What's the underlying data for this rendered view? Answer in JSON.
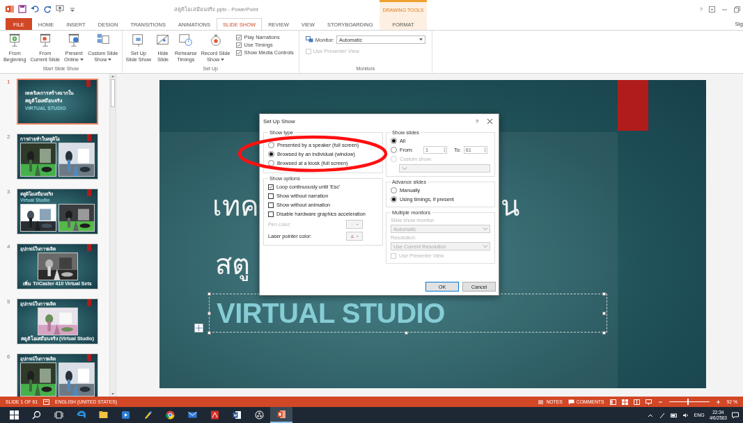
{
  "title_bar": {
    "title": "สตูดิโอเสมือนจริง.pptx - PowerPoint",
    "contextual_header": "DRAWING TOOLS",
    "help": "?",
    "account": "Sig"
  },
  "tabs": [
    {
      "label": "FILE",
      "kind": "file",
      "selected": false
    },
    {
      "label": "HOME",
      "kind": "tab",
      "selected": false
    },
    {
      "label": "INSERT",
      "kind": "tab",
      "selected": false
    },
    {
      "label": "DESIGN",
      "kind": "tab",
      "selected": false
    },
    {
      "label": "TRANSITIONS",
      "kind": "tab",
      "selected": false
    },
    {
      "label": "ANIMATIONS",
      "kind": "tab",
      "selected": false
    },
    {
      "label": "SLIDE SHOW",
      "kind": "tab",
      "selected": true
    },
    {
      "label": "REVIEW",
      "kind": "tab",
      "selected": false
    },
    {
      "label": "VIEW",
      "kind": "tab",
      "selected": false
    },
    {
      "label": "STORYBOARDING",
      "kind": "tab",
      "selected": false
    },
    {
      "label": "FORMAT",
      "kind": "contextual",
      "selected": false
    }
  ],
  "ribbon": {
    "groups": [
      {
        "label": "Start Slide Show",
        "items": [
          {
            "kind": "button",
            "label": "From\nBeginning",
            "menu": false
          },
          {
            "kind": "button",
            "label": "From\nCurrent Slide",
            "menu": false
          },
          {
            "kind": "button",
            "label": "Present\nOnline",
            "menu": true
          },
          {
            "kind": "button",
            "label": "Custom Slide\nShow",
            "menu": true
          }
        ]
      },
      {
        "label": "Set Up",
        "items": [
          {
            "kind": "button",
            "label": "Set Up\nSlide Show",
            "menu": false
          },
          {
            "kind": "button",
            "label": "Hide\nSlide",
            "menu": false
          },
          {
            "kind": "button",
            "label": "Rehearse\nTimings",
            "menu": false
          },
          {
            "kind": "button",
            "label": "Record Slide\nShow",
            "menu": true
          },
          {
            "kind": "checks",
            "checks": [
              {
                "label": "Play Narrations",
                "checked": true
              },
              {
                "label": "Use Timings",
                "checked": true
              },
              {
                "label": "Show Media Controls",
                "checked": true
              }
            ]
          }
        ]
      },
      {
        "label": "Monitors",
        "items": [
          {
            "kind": "monitor",
            "label": "Monitor:",
            "value": "Automatic",
            "presenter": {
              "label": "Use Presenter View",
              "checked": false,
              "disabled": true
            }
          }
        ]
      }
    ]
  },
  "thumbnails": [
    {
      "number": "1",
      "selected": true,
      "kind": "title",
      "lines": [
        "เทคนิคการสร้างฉากใน",
        "สตูดิโอเสมือนจริง",
        "VIRTUAL STUDIO"
      ]
    },
    {
      "number": "2",
      "selected": false,
      "kind": "two_pictures",
      "lines": [
        "การถ่ายทำในสตูดิโอ"
      ]
    },
    {
      "number": "3",
      "selected": false,
      "kind": "two_pictures",
      "lines": [
        "สตูดิโอเสมือนจริง",
        "Virtual Studio"
      ]
    },
    {
      "number": "4",
      "selected": false,
      "kind": "one_picture",
      "lines": [
        "อุปกรณ์ในการผลิต"
      ],
      "caption": "เพิ่ม TriCaster 410 Virtual Sets"
    },
    {
      "number": "5",
      "selected": false,
      "kind": "one_picture",
      "lines": [
        "อุปกรณ์ในการผลิต"
      ],
      "caption": "สตูดิโอเสมือนจริง (Virtual Studio)"
    },
    {
      "number": "6",
      "selected": false,
      "kind": "two_pictures",
      "lines": [
        "อุปกรณ์ในการผลิต"
      ]
    }
  ],
  "slide": {
    "title_line1_left": "เทค",
    "title_line1_right": "น",
    "title_line2": "สตู",
    "subtitle": "VIRTUAL STUDIO",
    "subtitle_selected": true
  },
  "dialog": {
    "title": "Set Up Show",
    "help": "?",
    "show_type": {
      "label": "Show type",
      "options": [
        {
          "label": "Presented by a speaker (full screen)",
          "selected": false
        },
        {
          "label": "Browsed by an individual (window)",
          "selected": true
        },
        {
          "label": "Browsed at a kiosk (full screen)",
          "selected": false
        }
      ]
    },
    "show_options": {
      "label": "Show options",
      "checks": [
        {
          "label": "Loop continuously until 'Esc'",
          "checked": true
        },
        {
          "label": "Show without narration",
          "checked": false
        },
        {
          "label": "Show without animation",
          "checked": false
        },
        {
          "label": "Disable hardware graphics acceleration",
          "checked": false
        }
      ],
      "pen_color": {
        "label": "Pen color:",
        "disabled": true
      },
      "laser_color": {
        "label": "Laser pointer color:",
        "disabled": false
      }
    },
    "show_slides": {
      "label": "Show slides",
      "all": {
        "label": "All",
        "selected": true
      },
      "from": {
        "label": "From:",
        "selected": false,
        "value": "1"
      },
      "to": {
        "label": "To:",
        "value": "61"
      },
      "custom": {
        "label": "Custom show:",
        "selected": false,
        "disabled": true
      }
    },
    "advance": {
      "label": "Advance slides",
      "options": [
        {
          "label": "Manually",
          "selected": false
        },
        {
          "label": "Using timings, if present",
          "selected": true
        }
      ]
    },
    "monitors": {
      "label": "Multiple monitors",
      "disabled": true,
      "monitor_label": "Slide show monitor:",
      "monitor_value": "Automatic",
      "resolution_label": "Resolution:",
      "resolution_value": "Use Current Resolution",
      "presenter": {
        "label": "Use Presenter View",
        "checked": false
      }
    },
    "buttons": [
      "OK",
      "Cancel"
    ]
  },
  "status_bar": {
    "slide_info": "SLIDE 1 OF 61",
    "language": "ENGLISH (UNITED STATES)",
    "notes": "NOTES",
    "comments": "COMMENTS",
    "zoom_slider": {
      "level": 0.46
    },
    "zoom": "92 %"
  },
  "taskbar": {
    "apps": [
      {
        "selected": false
      },
      {
        "selected": false
      },
      {
        "selected": false
      },
      {
        "selected": false
      },
      {
        "selected": false
      },
      {
        "selected": false
      },
      {
        "selected": false
      },
      {
        "selected": false
      },
      {
        "selected": false
      },
      {
        "selected": false
      },
      {
        "selected": false
      },
      {
        "selected": false
      },
      {
        "selected": true
      }
    ],
    "language": "ENG",
    "time": "22:34",
    "date": "4/6/2563"
  }
}
